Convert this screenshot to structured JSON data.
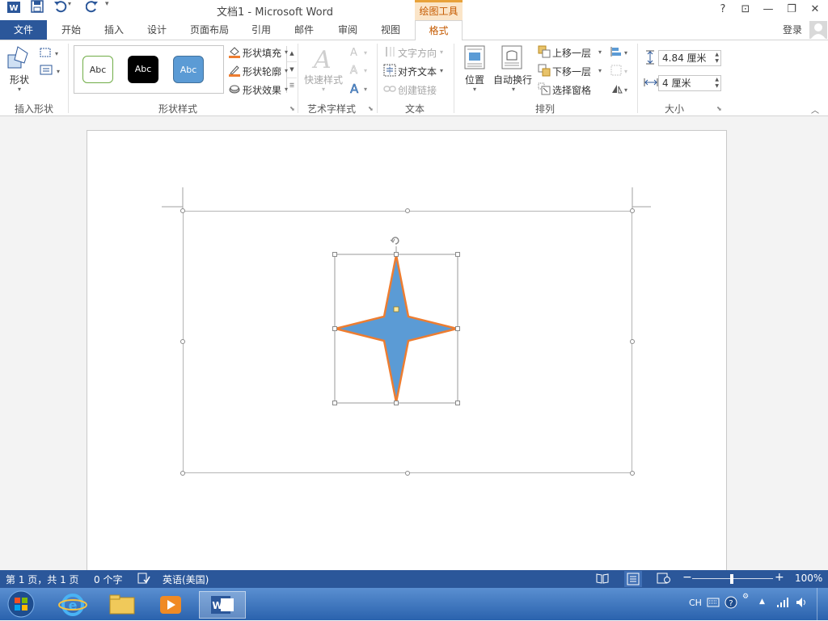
{
  "window": {
    "title": "文档1 - Microsoft Word",
    "contextual_label": "绘图工具",
    "help_glyph": "?",
    "ribbon_options_glyph": "⊡",
    "minimize_glyph": "—",
    "restore_glyph": "❐",
    "close_glyph": "✕"
  },
  "tabs": {
    "file": "文件",
    "home": "开始",
    "insert": "插入",
    "design": "设计",
    "layout": "页面布局",
    "references": "引用",
    "mailings": "邮件",
    "review": "审阅",
    "view": "视图",
    "format": "格式"
  },
  "account": {
    "login": "登录"
  },
  "ribbon": {
    "insert_shapes": {
      "label": "插入形状",
      "shapes_button": "形状"
    },
    "shape_styles": {
      "label": "形状样式",
      "swatch1": "Abc",
      "swatch2": "Abc",
      "swatch3": "Abc",
      "fill": "形状填充",
      "outline": "形状轮廓",
      "effects": "形状效果"
    },
    "wordart": {
      "label": "艺术字样式",
      "quick_styles": "快速样式"
    },
    "text": {
      "label": "文本",
      "direction": "文字方向",
      "align": "对齐文本",
      "link": "创建链接"
    },
    "arrange": {
      "label": "排列",
      "position": "位置",
      "wrap": "自动换行",
      "bring_forward": "上移一层",
      "send_backward": "下移一层",
      "selection_pane": "选择窗格"
    },
    "size": {
      "label": "大小",
      "height": "4.84 厘米",
      "width": "4 厘米"
    }
  },
  "statusbar": {
    "page": "第 1 页，共 1 页",
    "words": "0 个字",
    "language": "英语(美国)",
    "zoom": "100%",
    "zoom_minus": "−",
    "zoom_plus": "+"
  },
  "taskbar": {
    "lang": "CH"
  },
  "colors": {
    "accent_blue": "#2b579a",
    "contextual_orange": "#c55a00",
    "star_fill": "#5b9bd5",
    "star_outline": "#ed7d31"
  }
}
